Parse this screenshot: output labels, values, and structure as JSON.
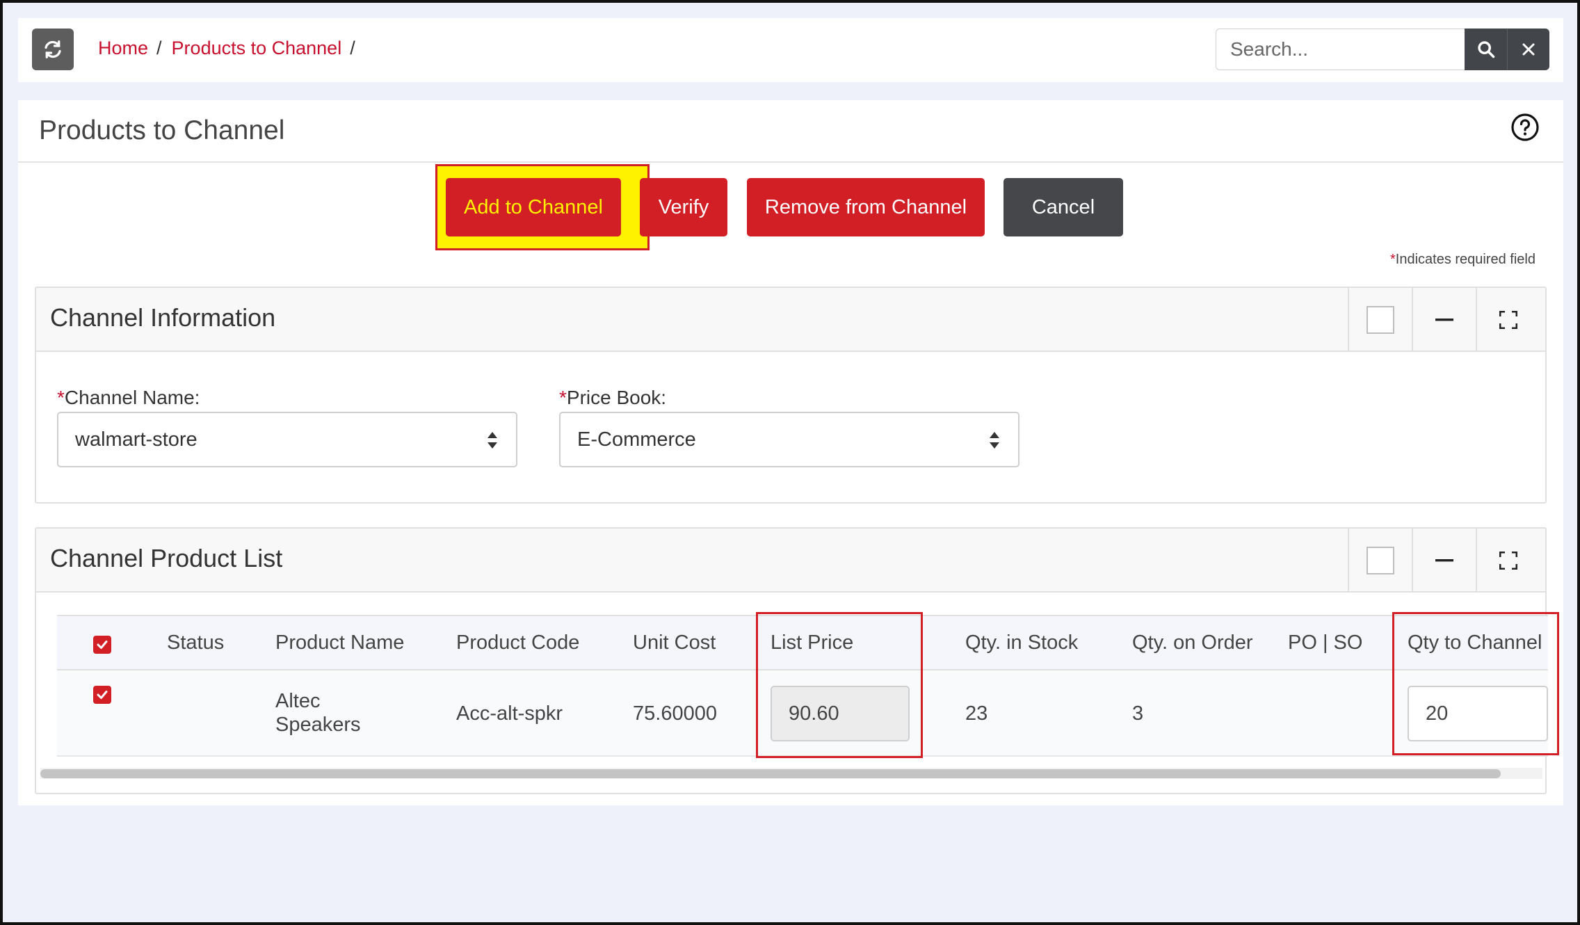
{
  "header": {
    "breadcrumb": [
      "Home",
      "Products to Channel"
    ],
    "search_placeholder": "Search..."
  },
  "page": {
    "title": "Products to Channel",
    "required_note": "Indicates required field"
  },
  "actions": {
    "add": "Add to Channel",
    "verify": "Verify",
    "remove": "Remove from Channel",
    "cancel": "Cancel"
  },
  "channel_info": {
    "title": "Channel Information",
    "channel_name_label": "Channel Name:",
    "channel_name_value": "walmart-store",
    "price_book_label": "Price Book:",
    "price_book_value": "E-Commerce"
  },
  "product_list": {
    "title": "Channel Product List",
    "columns": [
      "Status",
      "Product Name",
      "Product Code",
      "Unit Cost",
      "List Price",
      "Qty. in Stock",
      "Qty. on Order",
      "PO | SO",
      "Qty to Channel"
    ],
    "rows": [
      {
        "checked": true,
        "status": "",
        "product_name_line1": "Altec",
        "product_name_line2": "Speakers",
        "product_code": "Acc-alt-spkr",
        "unit_cost": "75.60000",
        "list_price": "90.60",
        "qty_in_stock": "23",
        "qty_on_order": "3",
        "po_so": "",
        "qty_to_channel": "20"
      }
    ]
  },
  "colors": {
    "accent_red": "#d11f25",
    "dark_button": "#45474b",
    "highlight_yellow": "#fff200"
  }
}
